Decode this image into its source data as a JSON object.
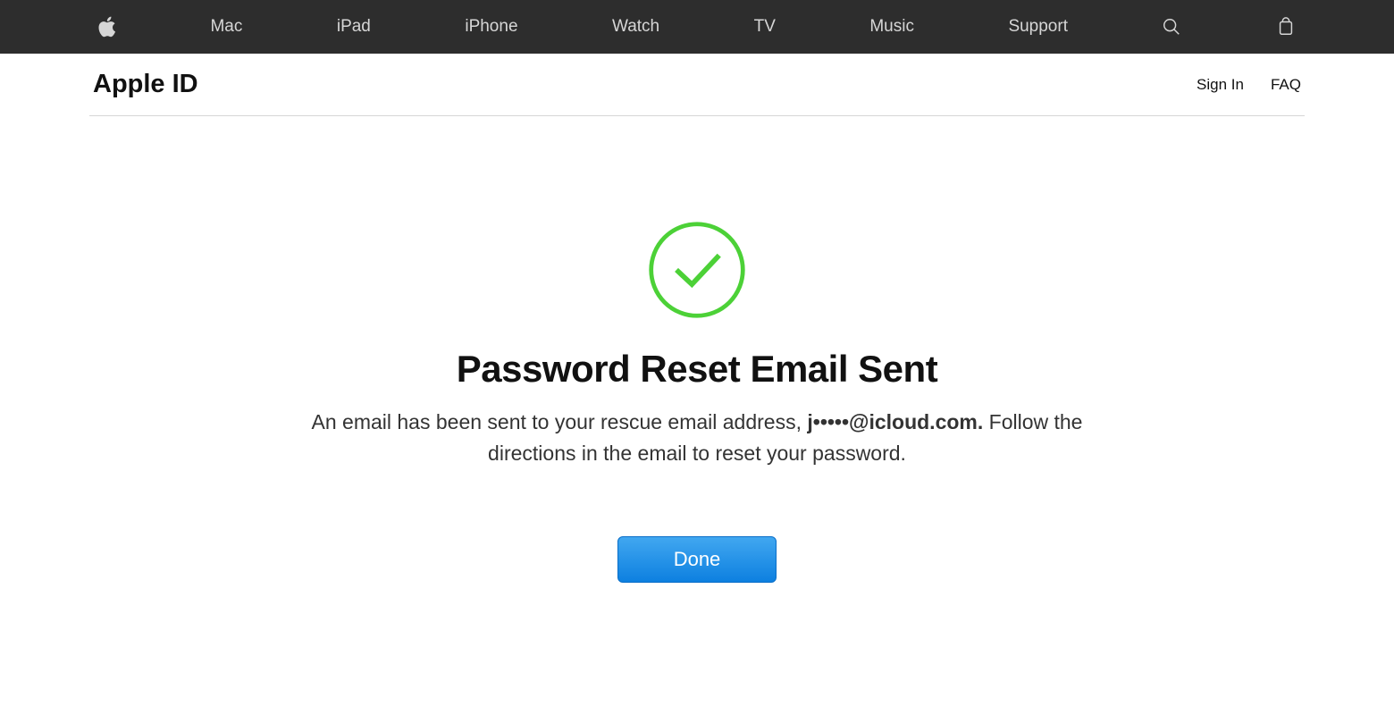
{
  "globalNav": {
    "items": [
      {
        "label": "Mac"
      },
      {
        "label": "iPad"
      },
      {
        "label": "iPhone"
      },
      {
        "label": "Watch"
      },
      {
        "label": "TV"
      },
      {
        "label": "Music"
      },
      {
        "label": "Support"
      }
    ]
  },
  "localNav": {
    "title": "Apple ID",
    "signIn": "Sign In",
    "faq": "FAQ"
  },
  "main": {
    "headline": "Password Reset Email Sent",
    "descPrefix": "An email has been sent to your rescue email address, ",
    "email": "j•••••@icloud.com.",
    "descSuffix": " Follow the directions in the email to reset your password.",
    "doneLabel": "Done"
  },
  "colors": {
    "successGreen": "#4cd137",
    "buttonBlue": "#1e90e8"
  }
}
